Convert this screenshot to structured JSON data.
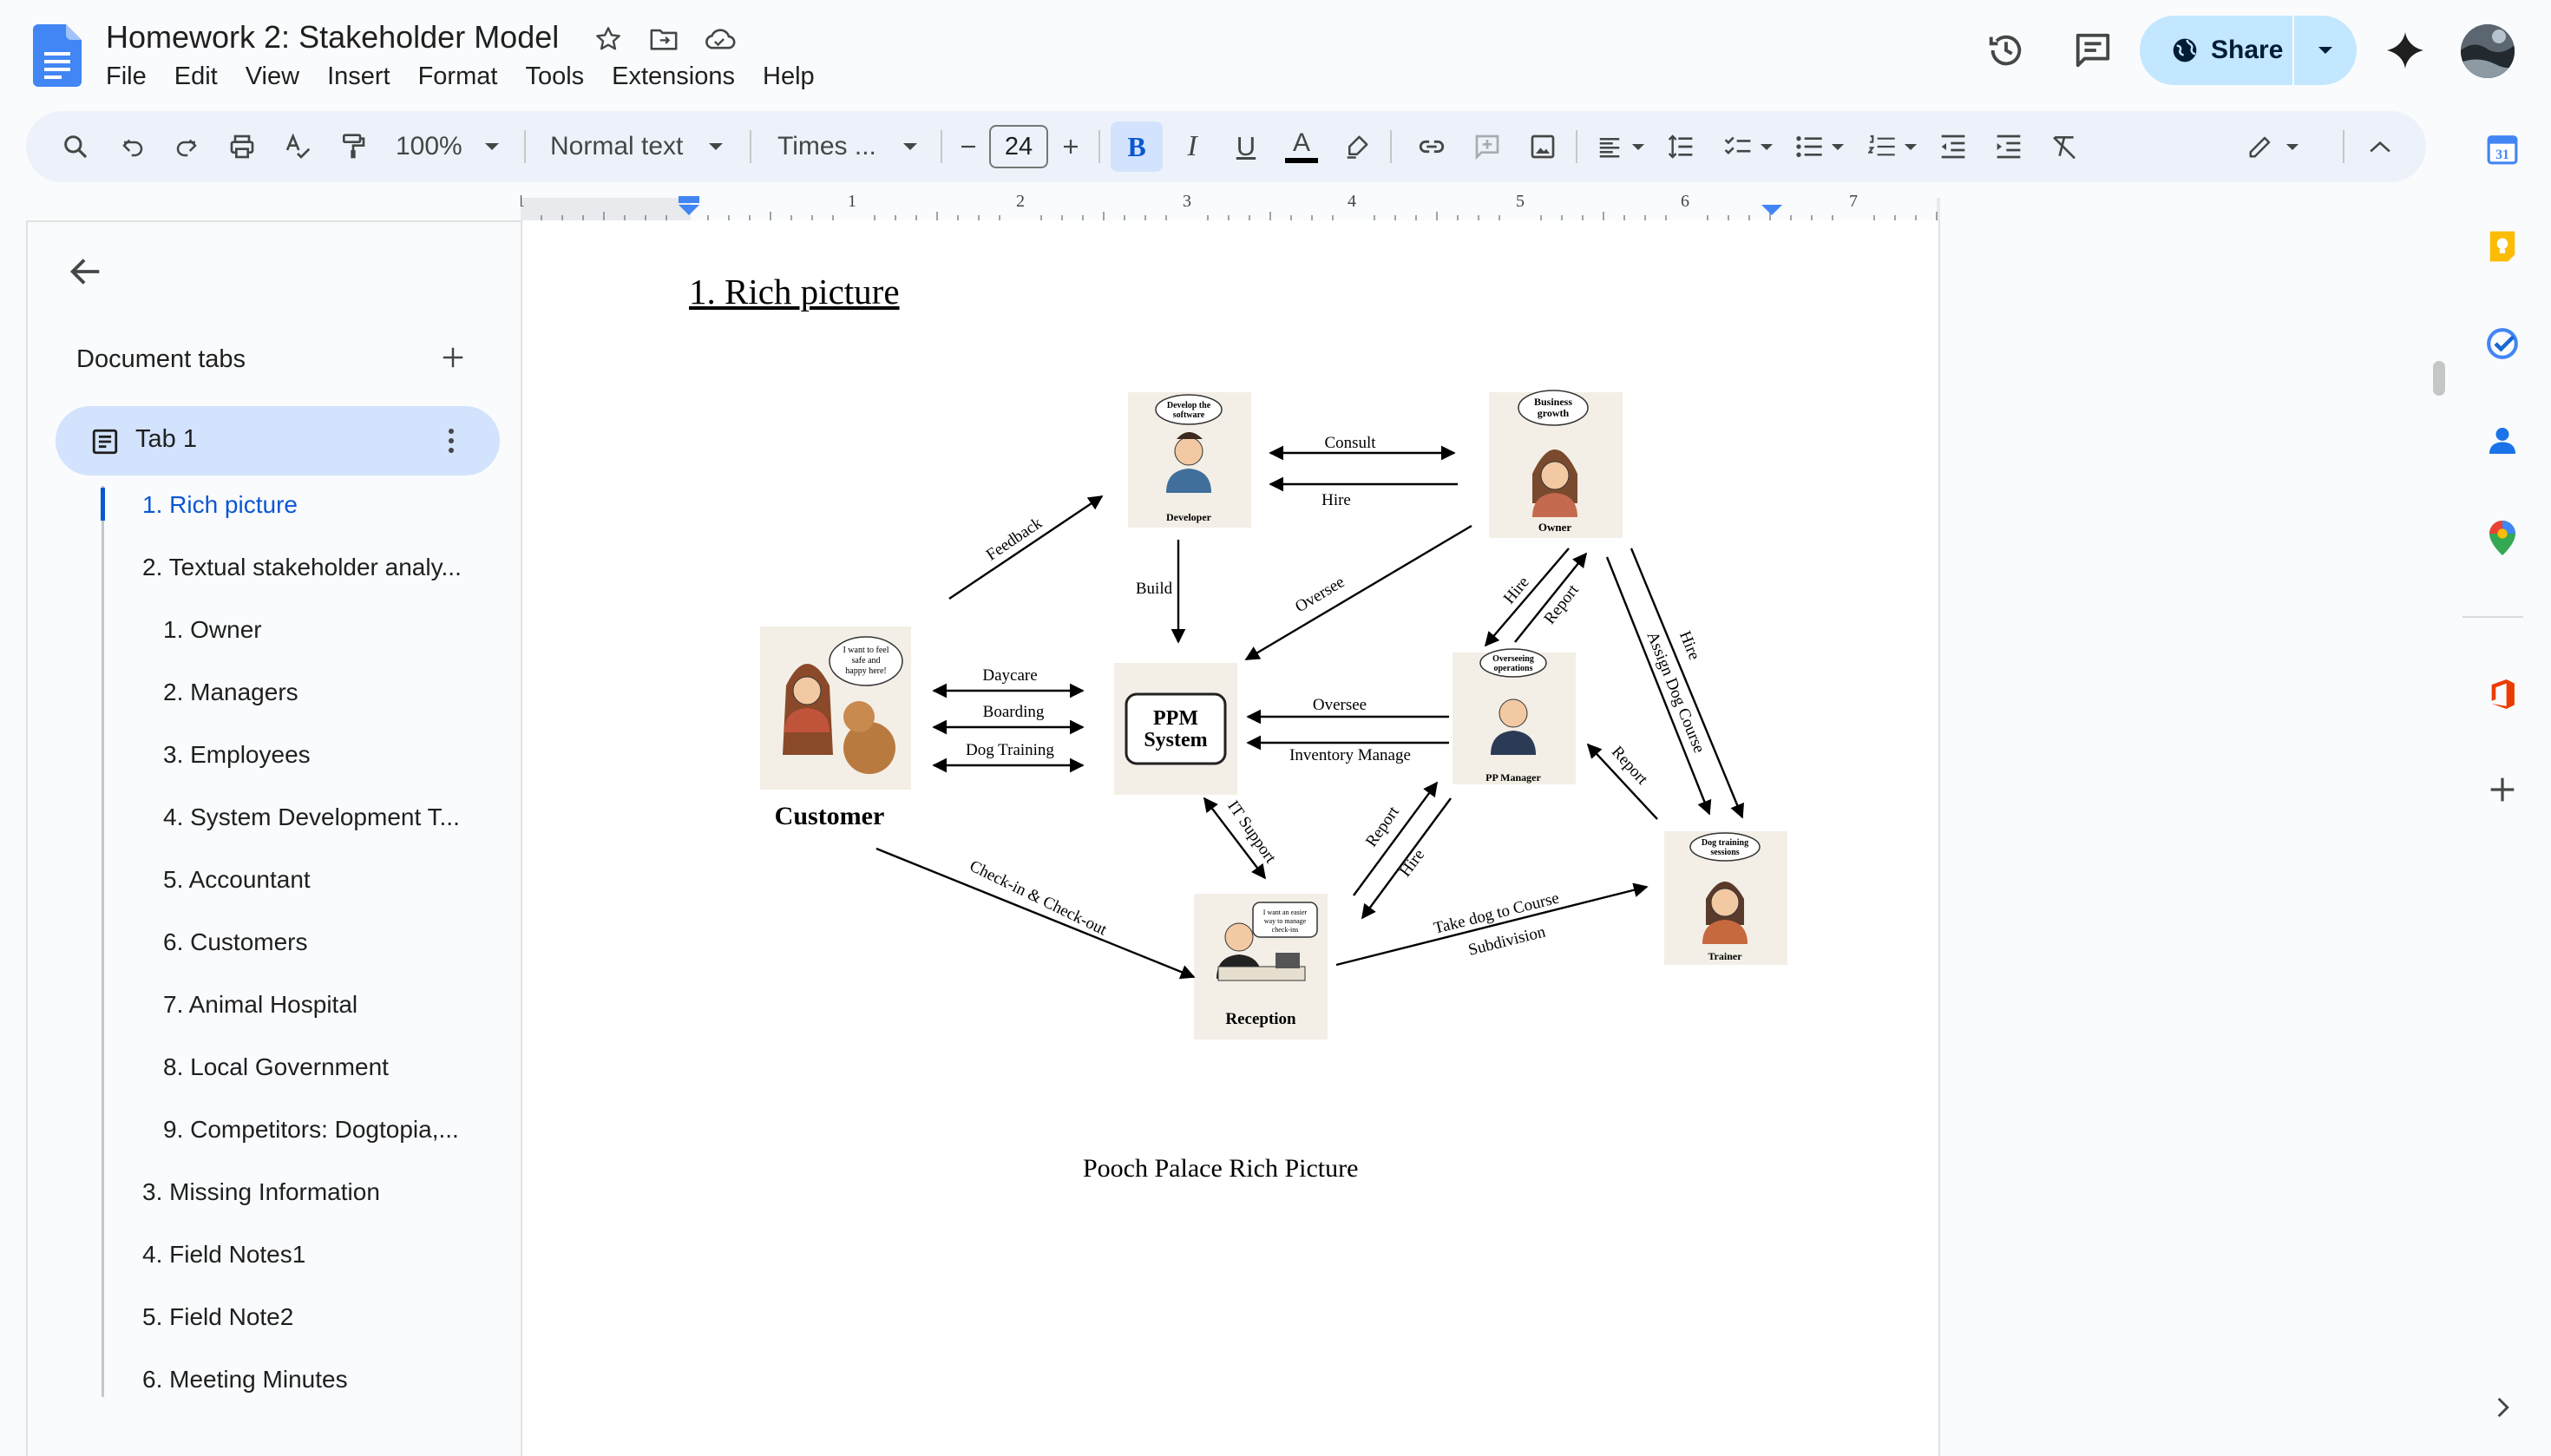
{
  "app": {
    "title": "Homework 2: Stakeholder Model",
    "menu": [
      "File",
      "Edit",
      "View",
      "Insert",
      "Format",
      "Tools",
      "Extensions",
      "Help"
    ],
    "share_label": "Share"
  },
  "toolbar": {
    "zoom": "100%",
    "style": "Normal text",
    "font": "Times ...",
    "font_size": "24",
    "bold_glyph": "B",
    "italic_glyph": "I",
    "underline_glyph": "U",
    "text_color_glyph": "A"
  },
  "ruler": {
    "labels": [
      "1",
      "1",
      "2",
      "3",
      "4",
      "5",
      "6",
      "7"
    ]
  },
  "sidebar": {
    "section_title": "Document tabs",
    "tab_label": "Tab 1",
    "outline": [
      "1. Rich picture",
      "2. Textual stakeholder analy...",
      "1. Owner",
      "2. Managers",
      "3. Employees",
      "4. System Development T...",
      "5. Accountant",
      "6. Customers",
      "7. Animal Hospital",
      "8. Local Government",
      "9. Competitors: Dogtopia,...",
      "3. Missing Information",
      "4. Field Notes1",
      "5. Field Note2",
      "6. Meeting Minutes"
    ]
  },
  "document": {
    "heading": "1. Rich picture",
    "caption": "Pooch Palace Rich Picture"
  },
  "diagram": {
    "nodes": {
      "developer": {
        "label": "Developer",
        "bubble": [
          "Develop the",
          "software"
        ]
      },
      "owner": {
        "label": "Owner",
        "bubble": [
          "Business",
          "growth"
        ]
      },
      "customer": {
        "label": "Customer",
        "bubble": [
          "I want to feel",
          "safe and",
          "happy here!"
        ]
      },
      "system": {
        "label_line1": "PPM",
        "label_line2": "System"
      },
      "manager": {
        "label": "PP Manager",
        "bubble": [
          "Overseeing",
          "operations"
        ]
      },
      "reception": {
        "label": "Reception",
        "bubble": [
          "I want an easier",
          "way to manage",
          "check-ins"
        ]
      },
      "trainer": {
        "label": "Trainer",
        "bubble": [
          "Dog training",
          "sessions"
        ]
      }
    },
    "edges": {
      "consult": "Consult",
      "hire": "Hire",
      "feedback": "Feedback",
      "build": "Build",
      "oversee_owner": "Oversee",
      "hire_owner_mgr": "Hire",
      "report_mgr_owner": "Report",
      "assign_course": "Assign Dog Course",
      "hire_owner_trainer": "Hire",
      "daycare": "Daycare",
      "boarding": "Boarding",
      "dog_training": "Dog Training",
      "oversee_mgr": "Oversee",
      "inventory": "Inventory Manage",
      "report_trainer": "Report",
      "it_support": "IT Support",
      "report_reception": "Report",
      "hire_mgr_reception": "Hire",
      "checkin": "Check-in & Check-out",
      "take_dog_1": "Take dog to Course",
      "take_dog_2": "Subdivision"
    }
  }
}
